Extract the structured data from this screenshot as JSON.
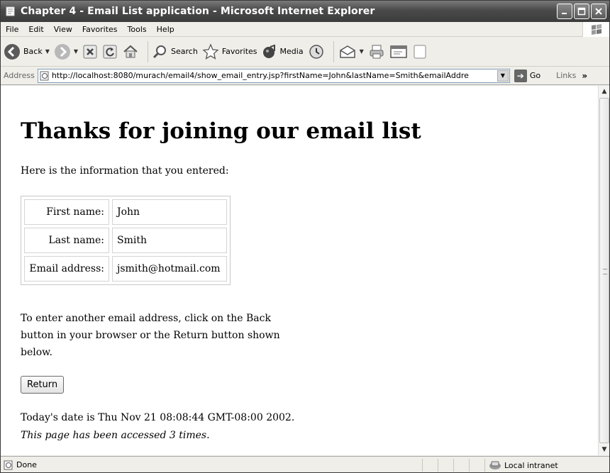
{
  "window": {
    "title": "Chapter 4 - Email List application - Microsoft Internet Explorer"
  },
  "menu": [
    "File",
    "Edit",
    "View",
    "Favorites",
    "Tools",
    "Help"
  ],
  "toolbar": {
    "back_label": "Back",
    "search_label": "Search",
    "favorites_label": "Favorites",
    "media_label": "Media"
  },
  "address": {
    "label": "Address",
    "url": "http://localhost:8080/murach/email4/show_email_entry.jsp?firstName=John&lastName=Smith&emailAddre",
    "go_label": "Go",
    "links_label": "Links",
    "links_chevron": "»"
  },
  "page": {
    "heading": "Thanks for joining our email list",
    "intro": "Here is the information that you entered:",
    "rows": [
      {
        "label": "First name:",
        "value": "John"
      },
      {
        "label": "Last name:",
        "value": "Smith"
      },
      {
        "label": "Email address:",
        "value": "jsmith@hotmail.com"
      }
    ],
    "instructions": "To enter another email address, click on the Back button in your browser or the Return button shown below.",
    "return_label": "Return",
    "date_line": "Today's date is Thu Nov 21 08:08:44 GMT-08:00 2002.",
    "count_prefix": "This page has been accessed ",
    "count": "3",
    "count_suffix": " times."
  },
  "status": {
    "text": "Done",
    "zone": "Local intranet"
  }
}
